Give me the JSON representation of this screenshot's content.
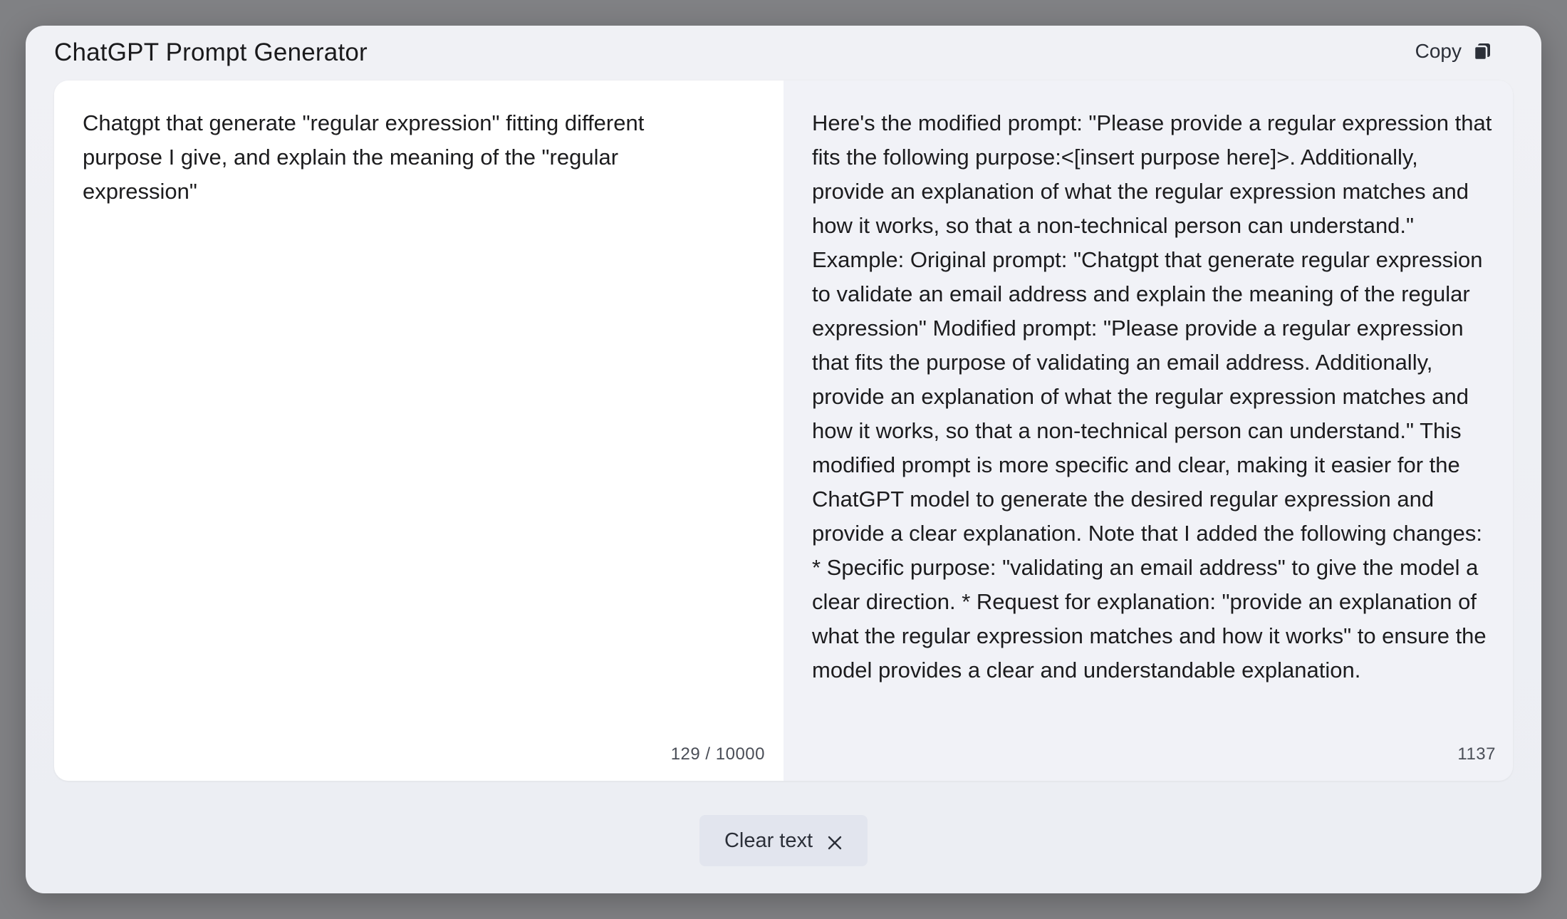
{
  "header": {
    "title": "ChatGPT Prompt Generator",
    "copy_label": "Copy",
    "copy_icon": "copy-icon"
  },
  "input": {
    "value": "Chatgpt that generate \"regular expression\" fitting different purpose I give, and explain the meaning of the \"regular expression\"",
    "counter": "129 / 10000"
  },
  "output": {
    "text": "Here's the modified prompt: \"Please provide a regular expression that fits the following purpose:<[insert purpose here]>. Additionally, provide an explanation of what the regular expression matches and how it works, so that a non-technical person can understand.\" Example: Original prompt: \"Chatgpt that generate regular expression to validate an email address and explain the meaning of the regular expression\" Modified prompt: \"Please provide a regular expression that fits the purpose of validating an email address. Additionally, provide an explanation of what the regular expression matches and how it works, so that a non-technical person can understand.\" This modified prompt is more specific and clear, making it easier for the ChatGPT model to generate the desired regular expression and provide a clear explanation. Note that I added the following changes: * Specific purpose: \"validating an email address\" to give the model a clear direction. * Request for explanation: \"provide an explanation of what the regular expression matches and how it works\" to ensure the model provides a clear and understandable explanation.",
    "counter": "1137"
  },
  "footer": {
    "clear_label": "Clear text",
    "clear_icon": "close-icon"
  }
}
